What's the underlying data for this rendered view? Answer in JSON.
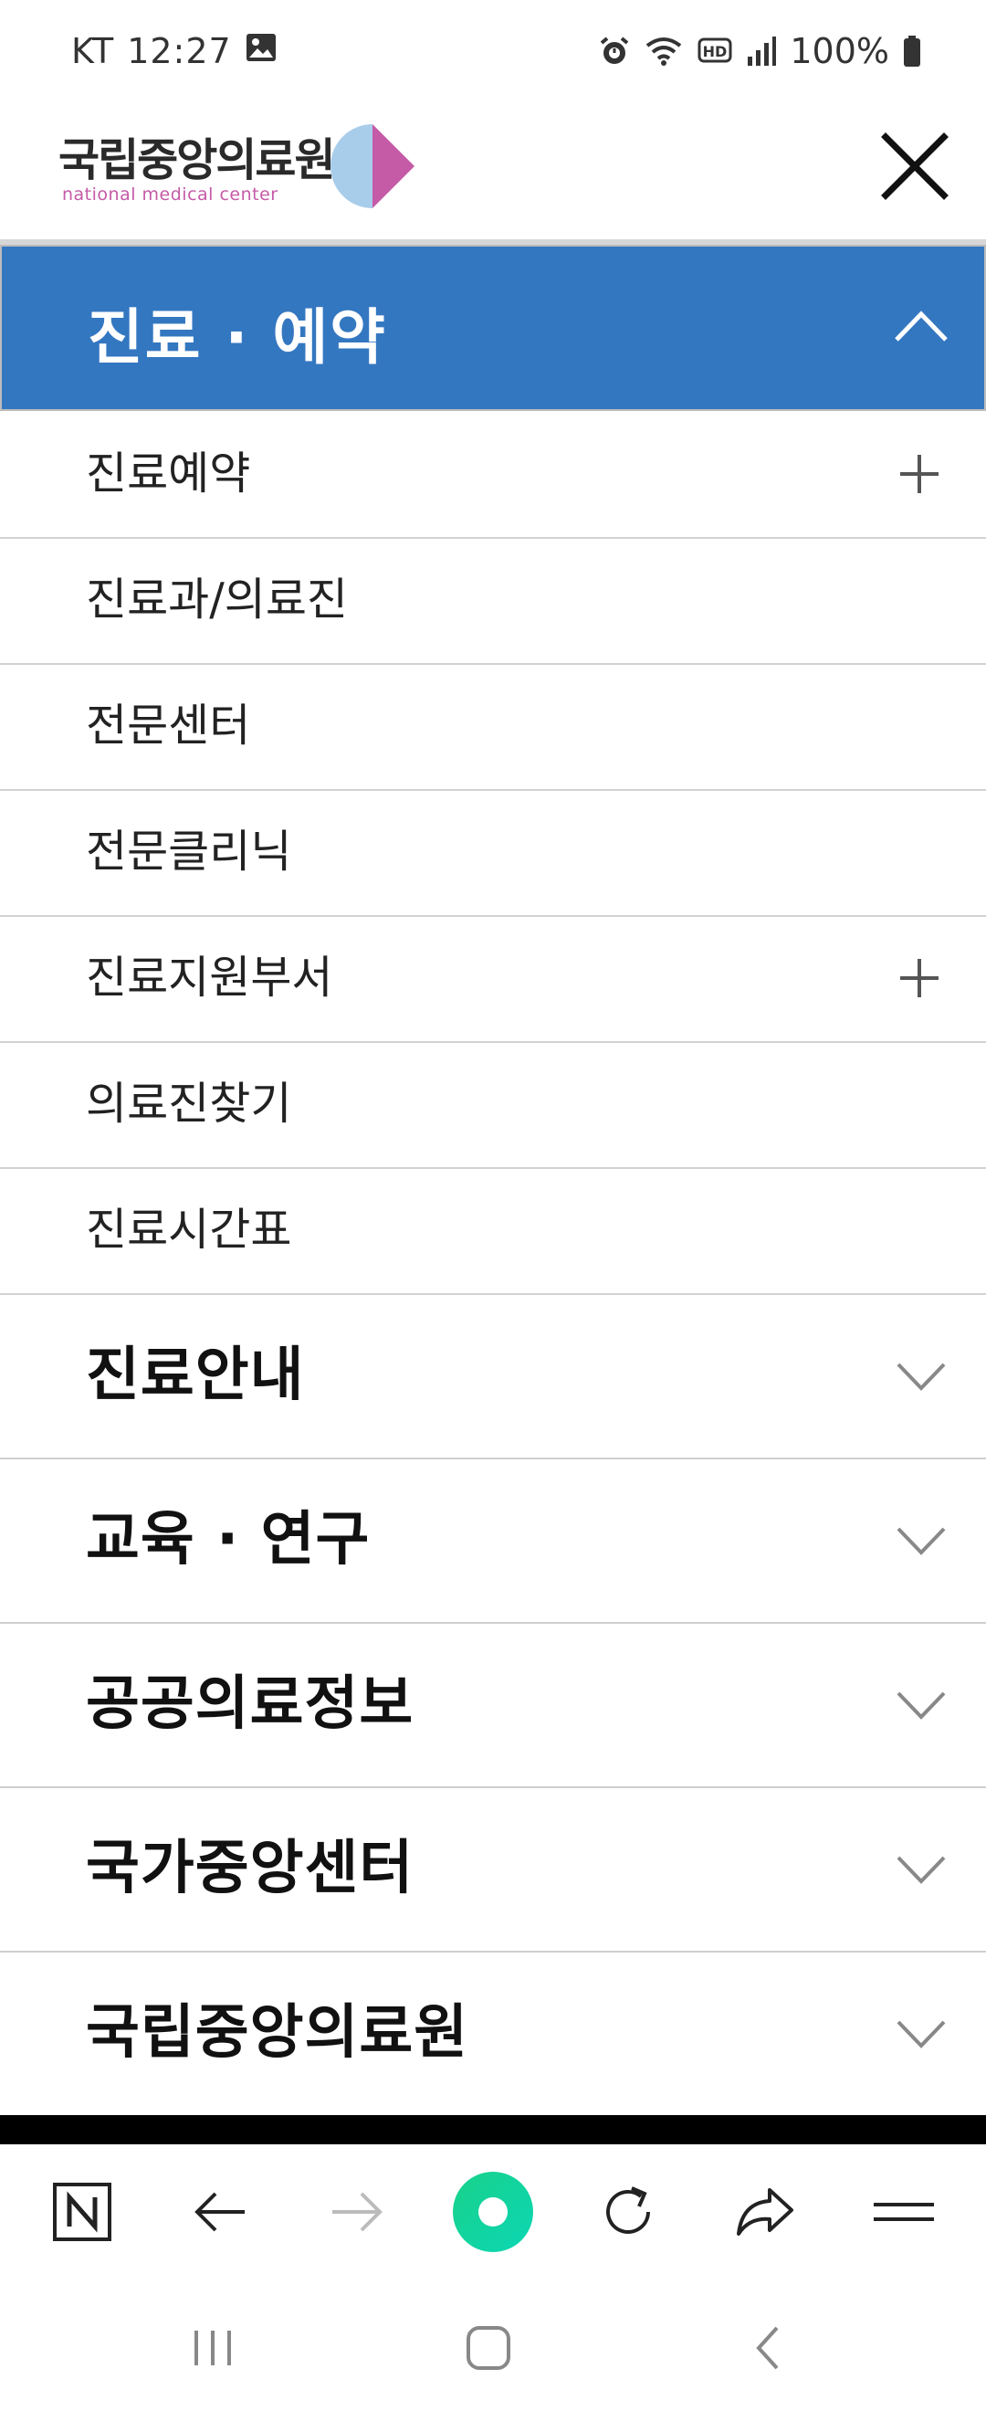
{
  "status_bar": {
    "carrier": "KT",
    "time": "12:27",
    "battery": "100%",
    "icons": [
      "gallery-icon",
      "alarm-icon",
      "wifi-icon",
      "hd-icon",
      "signal-icon",
      "battery-icon"
    ]
  },
  "header": {
    "logo_ko": "국립중앙의료원",
    "logo_en": "national medical center",
    "close_icon": "close-icon"
  },
  "menu": {
    "active_section": "진료 · 예약",
    "submenu": [
      {
        "label": "진료예약",
        "expandable": true
      },
      {
        "label": "진료과/의료진",
        "expandable": false
      },
      {
        "label": "전문센터",
        "expandable": false
      },
      {
        "label": "전문클리닉",
        "expandable": false
      },
      {
        "label": "진료지원부서",
        "expandable": true
      },
      {
        "label": "의료진찾기",
        "expandable": false
      },
      {
        "label": "진료시간표",
        "expandable": false
      }
    ],
    "sections": [
      "진료안내",
      "교육 · 연구",
      "공공의료정보",
      "국가중앙센터",
      "국립중앙의료원"
    ]
  },
  "browser_toolbar": [
    "naver-home-icon",
    "back-arrow-icon",
    "forward-arrow-icon",
    "green-dot-icon",
    "refresh-icon",
    "share-icon",
    "menu-icon"
  ],
  "colors": {
    "accent": "#3477c1",
    "logo_pink": "#c55aa6",
    "logo_blue": "#a8cdeb",
    "green_button": "#19d28a"
  }
}
